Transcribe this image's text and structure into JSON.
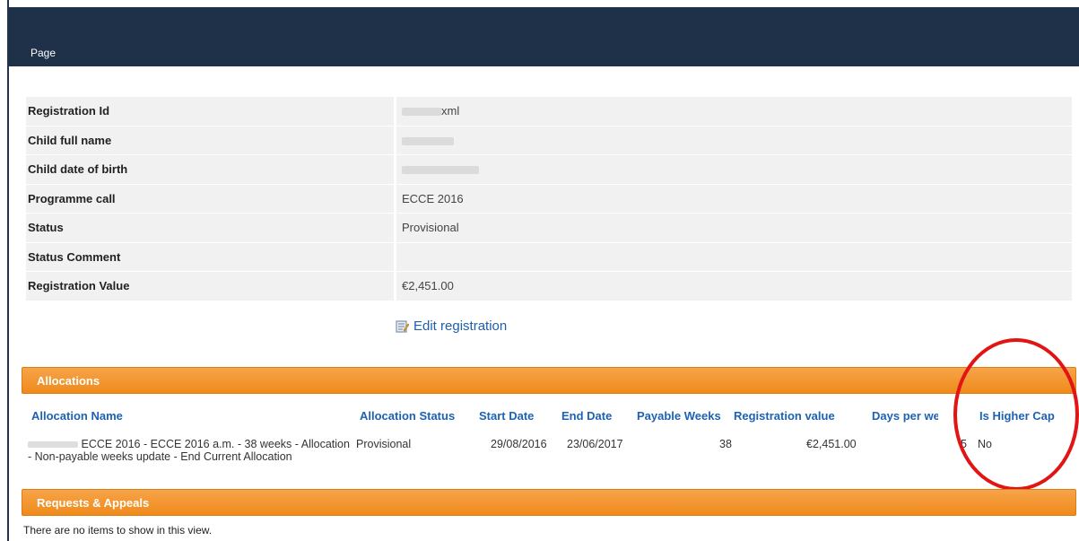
{
  "header": {
    "page_label": "Page"
  },
  "registration": {
    "rows": [
      {
        "label": "Registration Id",
        "value": "xml",
        "redacted": true
      },
      {
        "label": "Child full name",
        "value": "",
        "redacted": true
      },
      {
        "label": "Child date of birth",
        "value": "",
        "redacted": true
      },
      {
        "label": "Programme call",
        "value": "ECCE 2016",
        "redacted": false
      },
      {
        "label": "Status",
        "value": "Provisional",
        "redacted": false
      },
      {
        "label": "Status Comment",
        "value": "",
        "redacted": false
      },
      {
        "label": "Registration Value",
        "value": "€2,451.00",
        "redacted": false
      }
    ],
    "edit_link": "Edit registration"
  },
  "allocations": {
    "title": "Allocations",
    "columns": [
      "Allocation Name",
      "Allocation Status",
      "Start Date",
      "End Date",
      "Payable Weeks",
      "Registration value",
      "Days per week",
      "Is Higher Cap"
    ],
    "rows": [
      {
        "name_line1": "ECCE 2016 - ECCE 2016 a.m. - 38 weeks - Allocation",
        "name_line2": "- Non-payable weeks update - End Current Allocation",
        "status": "Provisional",
        "start": "29/08/2016",
        "end": "23/06/2017",
        "payable_weeks": "38",
        "value": "€2,451.00",
        "days": "5",
        "higher_cap": "No"
      }
    ]
  },
  "requests": {
    "title": "Requests & Appeals",
    "empty_message": "There are no items to show in this view."
  },
  "colors": {
    "header_bg": "#1f3148",
    "accent_orange": "#ef8a1a",
    "link_blue": "#1d62b3",
    "highlight_red": "#e21515"
  },
  "icons": {
    "edit": "edit-form-icon"
  }
}
